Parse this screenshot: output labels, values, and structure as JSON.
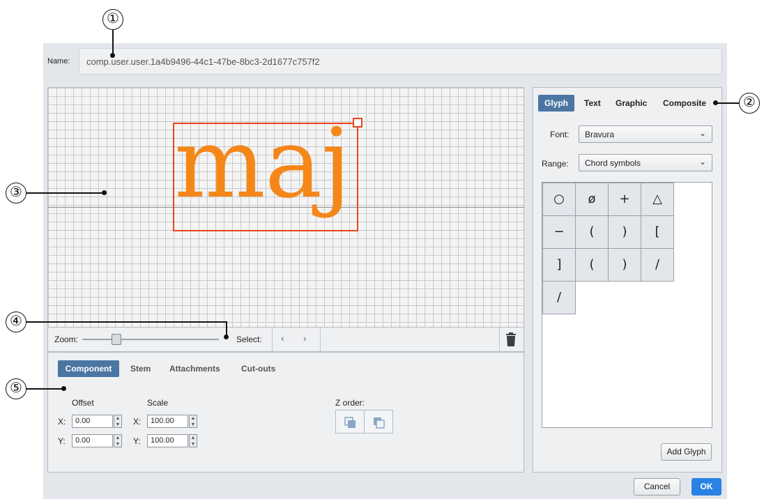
{
  "callouts": [
    "①",
    "②",
    "③",
    "④",
    "⑤"
  ],
  "name": {
    "label": "Name:",
    "value": "comp.user.user.1a4b9496-44c1-47be-8bc3-2d1677c757f2"
  },
  "canvas": {
    "glyph_text": "maj",
    "glyph_color": "#f5871a",
    "selection_color": "#e8451e"
  },
  "toolbar": {
    "zoom_label": "Zoom:",
    "zoom_level": 0.25,
    "select_label": "Select:",
    "prev": "‹",
    "next": "›",
    "trash_icon": "trash-icon"
  },
  "bottom_tabs": [
    "Component",
    "Stem",
    "Attachments",
    "Cut-outs"
  ],
  "component": {
    "offset_label": "Offset",
    "scale_label": "Scale",
    "zorder_label": "Z order:",
    "x_label": "X:",
    "y_label": "Y:",
    "offset_x": "0.00",
    "offset_y": "0.00",
    "scale_x": "100.00",
    "scale_y": "100.00"
  },
  "right_tabs": [
    "Glyph",
    "Text",
    "Graphic",
    "Composite"
  ],
  "font": {
    "label": "Font:",
    "value": "Bravura"
  },
  "range": {
    "label": "Range:",
    "value": "Chord symbols"
  },
  "glyph_grid": [
    "○",
    "ø",
    "+",
    "△",
    "−",
    "(",
    ")",
    "[",
    "]",
    "(",
    ")",
    "/",
    "/"
  ],
  "add_glyph": "Add Glyph",
  "cancel": "Cancel",
  "ok": "OK",
  "accent": "#4b76a3",
  "ok_color": "#2a82e4"
}
